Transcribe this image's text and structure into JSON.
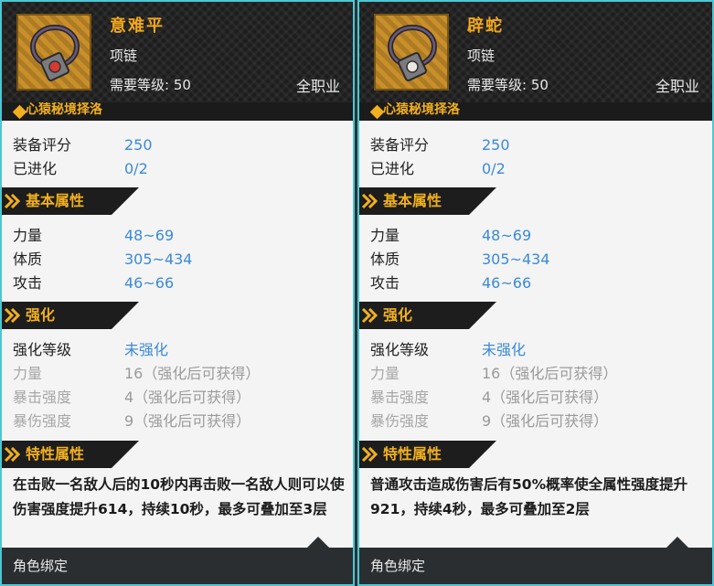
{
  "items": [
    {
      "name": "意难平",
      "type": "项链",
      "level": "需要等级: 50",
      "class": "全职业",
      "set_name": "心猿秘境择洛",
      "gem_color": "#d83a2f",
      "score_label": "装备评分",
      "score": "250",
      "evolve_label": "已进化",
      "evolve": "0/2",
      "basic_title": "基本属性",
      "basic_stats": [
        {
          "label": "力量",
          "value": "48~69"
        },
        {
          "label": "体质",
          "value": "305~434"
        },
        {
          "label": "攻击",
          "value": "46~66"
        }
      ],
      "enhance_title": "强化",
      "enhance_level_label": "强化等级",
      "enhance_level": "未强化",
      "enhance_stats": [
        {
          "label": "力量",
          "value": "16（强化后可获得）"
        },
        {
          "label": "暴击强度",
          "value": "4（强化后可获得）"
        },
        {
          "label": "暴伤强度",
          "value": "9（强化后可获得）"
        }
      ],
      "trait_title": "特性属性",
      "trait_text": "在击败一名敌人后的10秒内再击败一名敌人则可以使伤害强度提升614，持续10秒，最多可叠加至3层",
      "footer": "角色绑定"
    },
    {
      "name": "辟蛇",
      "type": "项链",
      "level": "需要等级: 50",
      "class": "全职业",
      "set_name": "心猿秘境择洛",
      "gem_color": "#eae6de",
      "score_label": "装备评分",
      "score": "250",
      "evolve_label": "已进化",
      "evolve": "0/2",
      "basic_title": "基本属性",
      "basic_stats": [
        {
          "label": "力量",
          "value": "48~69"
        },
        {
          "label": "体质",
          "value": "305~434"
        },
        {
          "label": "攻击",
          "value": "46~66"
        }
      ],
      "enhance_title": "强化",
      "enhance_level_label": "强化等级",
      "enhance_level": "未强化",
      "enhance_stats": [
        {
          "label": "力量",
          "value": "16（强化后可获得）"
        },
        {
          "label": "暴击强度",
          "value": "4（强化后可获得）"
        },
        {
          "label": "暴伤强度",
          "value": "9（强化后可获得）"
        }
      ],
      "trait_title": "特性属性",
      "trait_text": "普通攻击造成伤害后有50%概率使全属性强度提升921，持续4秒，最多可叠加至2层",
      "footer": "角色绑定"
    }
  ]
}
